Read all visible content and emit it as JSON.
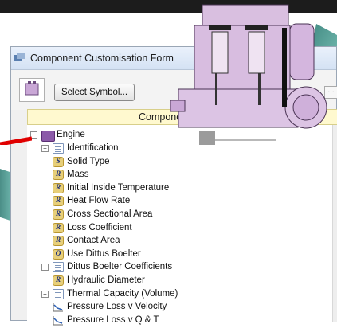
{
  "window": {
    "title": "Component Customisation Form"
  },
  "toolbar": {
    "select_symbol_label": "Select Symbol...",
    "small_dropdown": "..."
  },
  "panel": {
    "header": "Compone"
  },
  "tree": {
    "root": {
      "label": "Engine",
      "icon": "engine-icon"
    },
    "items": [
      {
        "label": "Identification",
        "icon": "document-icon",
        "expander": "+"
      },
      {
        "label": "Solid Type",
        "icon": "tag-icon",
        "tag": "S"
      },
      {
        "label": "Mass",
        "icon": "tag-icon",
        "tag": "R"
      },
      {
        "label": "Initial Inside Temperature",
        "icon": "tag-icon",
        "tag": "R"
      },
      {
        "label": "Heat Flow Rate",
        "icon": "tag-icon",
        "tag": "R"
      },
      {
        "label": "Cross Sectional Area",
        "icon": "tag-icon",
        "tag": "R"
      },
      {
        "label": "Loss Coefficient",
        "icon": "tag-icon",
        "tag": "R"
      },
      {
        "label": "Contact Area",
        "icon": "tag-icon",
        "tag": "R"
      },
      {
        "label": "Use Dittus Boelter",
        "icon": "tag-icon",
        "tag": "O"
      },
      {
        "label": "Dittus Boelter Coefficients",
        "icon": "document-icon",
        "expander": "+"
      },
      {
        "label": "Hydraulic Diameter",
        "icon": "tag-icon",
        "tag": "R"
      },
      {
        "label": "Thermal Capacity (Volume)",
        "icon": "document-icon",
        "expander": "+"
      },
      {
        "label": "Pressure Loss v Velocity",
        "icon": "chart-icon"
      },
      {
        "label": "Pressure Loss v Q & T",
        "icon": "chart-icon"
      }
    ]
  },
  "colors": {
    "tag_fill": "#e7cf7a",
    "engine_fill": "#d6b5dd",
    "teal": "#5ba39a",
    "red_arrow": "#e00000"
  }
}
